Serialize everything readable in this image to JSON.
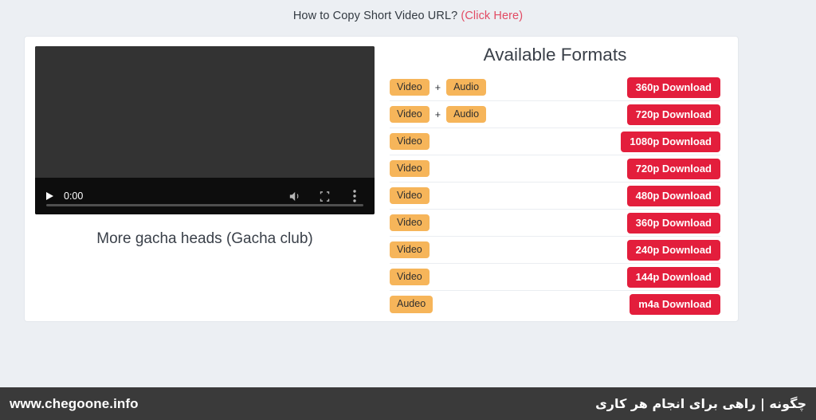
{
  "top_note": {
    "text": "How to Copy Short Video URL?",
    "link_label": "(Click Here)",
    "link_color": "#e24a63"
  },
  "player": {
    "current_time": "0:00",
    "progress_percent": 0,
    "title": "More gacha heads (Gacha club)",
    "controls": {
      "play_label": "play-button",
      "volume_label": "volume-icon",
      "fullscreen_label": "fullscreen-icon",
      "more_label": "more-options-icon"
    }
  },
  "formats": {
    "heading": "Available Formats",
    "plus_symbol": "+",
    "tag_color": "#f6b55a",
    "button_color": "#e31e3c",
    "rows": [
      {
        "tags": [
          "Video",
          "Audio"
        ],
        "has_plus": true,
        "download": "360p Download"
      },
      {
        "tags": [
          "Video",
          "Audio"
        ],
        "has_plus": true,
        "download": "720p Download"
      },
      {
        "tags": [
          "Video"
        ],
        "has_plus": false,
        "download": "1080p Download"
      },
      {
        "tags": [
          "Video"
        ],
        "has_plus": false,
        "download": "720p Download"
      },
      {
        "tags": [
          "Video"
        ],
        "has_plus": false,
        "download": "480p Download"
      },
      {
        "tags": [
          "Video"
        ],
        "has_plus": false,
        "download": "360p Download"
      },
      {
        "tags": [
          "Video"
        ],
        "has_plus": false,
        "download": "240p Download"
      },
      {
        "tags": [
          "Video"
        ],
        "has_plus": false,
        "download": "144p Download"
      },
      {
        "tags": [
          "Audeo"
        ],
        "has_plus": false,
        "download": "m4a Download"
      }
    ]
  },
  "footer": {
    "site": "www.chegoone.info",
    "slogan": "چگونه | راهی برای انجام هر کاری"
  }
}
